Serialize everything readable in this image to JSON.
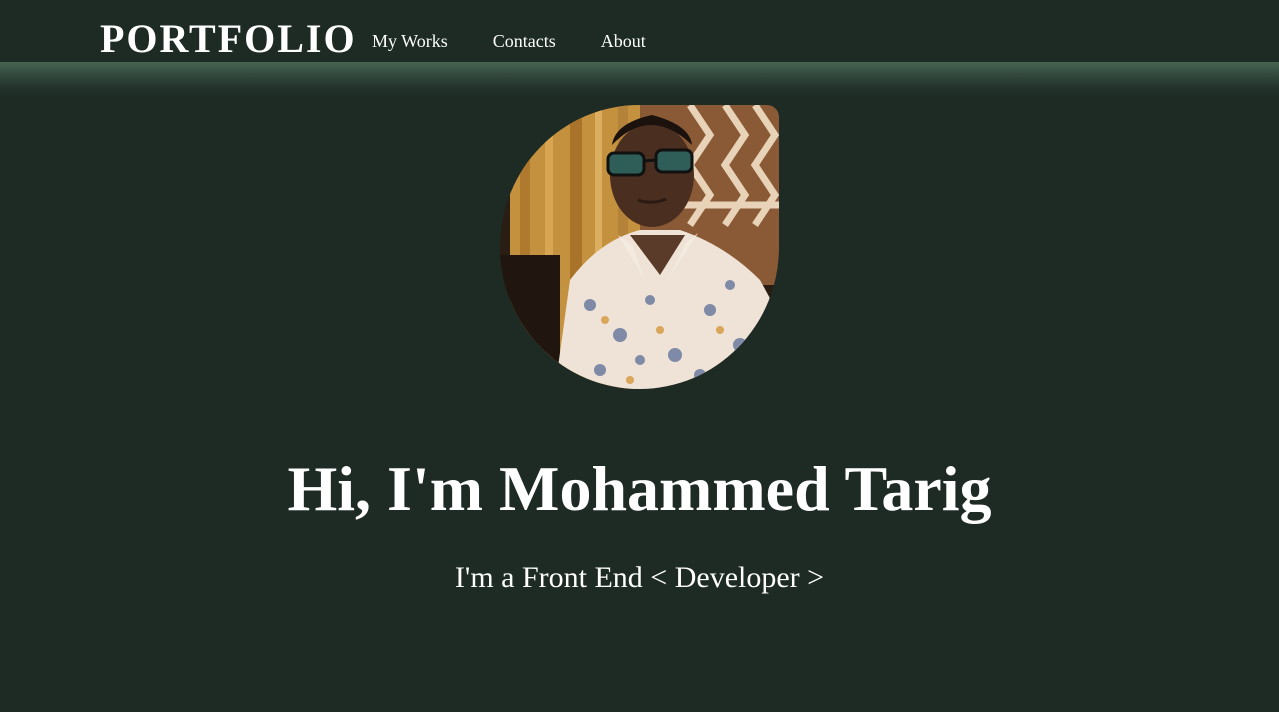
{
  "header": {
    "brand": "PORTFOLIO",
    "nav": [
      {
        "label": "My Works"
      },
      {
        "label": "Contacts"
      },
      {
        "label": "About"
      }
    ]
  },
  "hero": {
    "headline": "Hi, I'm Mohammed Tarig",
    "subheadline": "I'm a Front End < Developer >",
    "photo_icon": "profile-photo"
  },
  "colors": {
    "background": "#1d2b24",
    "header_glow": "#476352",
    "text": "#ffffff"
  }
}
